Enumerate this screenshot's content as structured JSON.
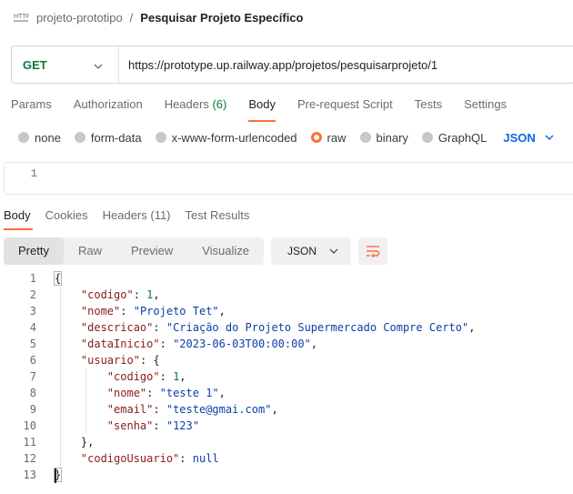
{
  "breadcrumb": {
    "icon": "http-icon",
    "parent": "projeto-prototipo",
    "separator": "/",
    "current": "Pesquisar Projeto Específico"
  },
  "request": {
    "method": "GET",
    "url": "https://prototype.up.railway.app/projetos/pesquisarprojeto/1"
  },
  "request_tabs": [
    {
      "label": "Params"
    },
    {
      "label": "Authorization"
    },
    {
      "label": "Headers",
      "count": "(6)"
    },
    {
      "label": "Body",
      "active": true
    },
    {
      "label": "Pre-request Script"
    },
    {
      "label": "Tests"
    },
    {
      "label": "Settings"
    }
  ],
  "body_types": {
    "options": [
      "none",
      "form-data",
      "x-www-form-urlencoded",
      "raw",
      "binary",
      "GraphQL"
    ],
    "selected": "raw",
    "format": "JSON"
  },
  "request_editor": {
    "line_numbers": [
      "1"
    ]
  },
  "response_tabs": [
    {
      "label": "Body",
      "active": true
    },
    {
      "label": "Cookies"
    },
    {
      "label": "Headers (11)"
    },
    {
      "label": "Test Results"
    }
  ],
  "view_modes": {
    "options": [
      "Pretty",
      "Raw",
      "Preview",
      "Visualize"
    ],
    "selected": "Pretty",
    "format": "JSON"
  },
  "response_lines": [
    "{",
    "    \"codigo\": 1,",
    "    \"nome\": \"Projeto Tet\",",
    "    \"descricao\": \"Criação do Projeto Supermercado Compre Certo\",",
    "    \"dataInicio\": \"2023-06-03T00:00:00\",",
    "    \"usuario\": {",
    "        \"codigo\": 1,",
    "        \"nome\": \"teste 1\",",
    "        \"email\": \"teste@gmai.com\",",
    "        \"senha\": \"123\"",
    "    },",
    "    \"codigoUsuario\": null",
    "}"
  ],
  "colors": {
    "accent": "#ff6c37",
    "method_get": "#0c7a3a",
    "link_blue": "#0b66e4"
  }
}
